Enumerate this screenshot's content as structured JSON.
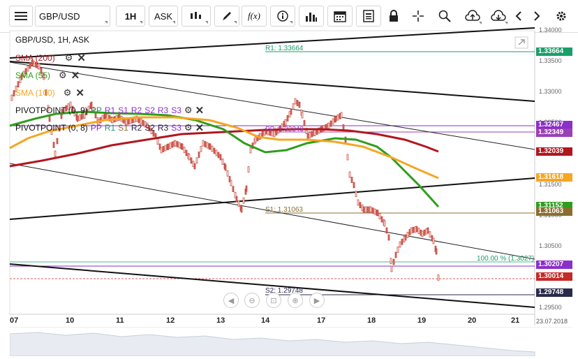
{
  "toolbar": {
    "symbol": "GBP/USD",
    "timeframe": "1H",
    "price_type": "ASK",
    "fx_label": "f(x)"
  },
  "chart_header": {
    "title": "GBP/USD, 1H, ASK"
  },
  "indicators": [
    {
      "label": "SMA (200)",
      "color": "#b0171f"
    },
    {
      "label": "SMA (55)",
      "color": "#2e9e1c"
    },
    {
      "label": "SMA (100)",
      "color": "#f5a623"
    }
  ],
  "pivots": [
    {
      "label": "PIVOTPOINT (0, 9)",
      "parts": [
        "PP",
        "R1",
        "S1",
        "R2",
        "S2",
        "R3",
        "S3"
      ]
    },
    {
      "label": "PIVOTPOINT (0, 8)",
      "parts": [
        "PP",
        "R1",
        "S1",
        "R2",
        "S2",
        "R3",
        "S3"
      ]
    }
  ],
  "line_labels": {
    "r1": "R1: 1.33664",
    "pp": "PP: 1.32349",
    "s1": "S1: 1.31063",
    "s2": "S2: 1.29748",
    "fib": "100.00 % (1.3027)"
  },
  "price_tags": [
    {
      "text": "1.33664",
      "color": "#1a9e6a",
      "price": 1.33664
    },
    {
      "text": "1.32467",
      "color": "#8b2fc9",
      "price": 1.32467
    },
    {
      "text": "1.32349",
      "color": "#9b3fb8",
      "price": 1.32349
    },
    {
      "text": "1.32039",
      "color": "#b0171f",
      "price": 1.32039
    },
    {
      "text": "1.31618",
      "color": "#f5a623",
      "price": 1.31618
    },
    {
      "text": "1.31152",
      "color": "#2e9e1c",
      "price": 1.31152
    },
    {
      "text": "1.31063",
      "color": "#8a6d2f",
      "price": 1.31063
    },
    {
      "text": "1.30207",
      "color": "#8b2fc9",
      "price": 1.30207
    },
    {
      "text": "1.30014",
      "color": "#c62828",
      "price": 1.30014
    },
    {
      "text": "1.29748",
      "color": "#2a2a4a",
      "price": 1.29748
    }
  ],
  "y_ticks": [
    "1.34000",
    "1.33500",
    "1.33000",
    "1.32500",
    "1.32000",
    "1.31500",
    "1.31000",
    "1.30500",
    "1.30000",
    "1.29500"
  ],
  "x_ticks": [
    "07",
    "10",
    "11",
    "12",
    "13",
    "14",
    "17",
    "18",
    "19",
    "20",
    "21"
  ],
  "date_label": "23.07.2018",
  "chart_data": {
    "type": "candlestick",
    "symbol": "GBP/USD",
    "timeframe": "1H",
    "ylim": [
      1.294,
      1.34
    ],
    "x_categories": [
      "07",
      "10",
      "11",
      "12",
      "13",
      "14",
      "17",
      "18",
      "19",
      "20",
      "21"
    ],
    "levels": {
      "R1": 1.33664,
      "PP": 1.32349,
      "S1": 1.31063,
      "S2": 1.29748,
      "fib_100": 1.3027,
      "current": 1.30014
    }
  }
}
